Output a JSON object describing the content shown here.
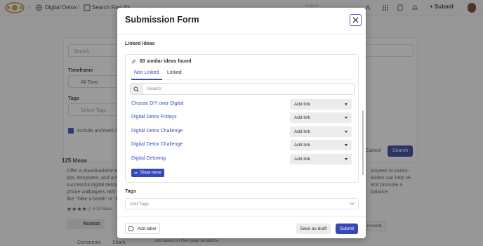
{
  "topbar": {
    "breadcrumb_sep_1": "/",
    "breadcrumb_1": "Digital Detox",
    "breadcrumb_sep_2": "/",
    "breadcrumb_2": "Search Results",
    "search_placeholder": "Search",
    "submit_label": "Submit"
  },
  "background": {
    "search_placeholder": "Search",
    "timeframe_label": "Timeframe",
    "timeframe_value": "All Time",
    "tags_label": "Tags",
    "tags_placeholder": "Select Tags",
    "include_archived": "Include archived ca",
    "cancel_label": "Cancel",
    "search_btn_label": "Search",
    "ideas_count": "125 Ideas",
    "idea_text_lines": [
      "Offer a downloadable to",
      "tips, templates, and acti",
      "successful digital detox.",
      "phone wallpapers with re",
      "like “Take a break” or “Be"
    ],
    "right_text_lines": [
      "ployees to partici-",
      "tivities can help re-",
      "and promote a",
      "balance."
    ],
    "rating": "4.13 Stars",
    "assess_label": "Assess",
    "comments_label": "Comments",
    "share_label": "Share",
    "rewards_label": "rewards",
    "bottom_snippet": "ues based on their peak productiv-"
  },
  "modal": {
    "title": "Submission Form",
    "linked_ideas_label": "Linked Ideas",
    "similar_found": "60 similar ideas found",
    "tabs": [
      {
        "label": "Non Linked",
        "active": true
      },
      {
        "label": "Linked",
        "active": false
      }
    ],
    "search_placeholder": "Search",
    "ideas": [
      {
        "title": "Choose DIY over Digital",
        "action": "Add link"
      },
      {
        "title": "Digital Detox Fridays",
        "action": "Add link"
      },
      {
        "title": "Digital Detox Challenge",
        "action": "Add link"
      },
      {
        "title": "Digital Detox Challenge",
        "action": "Add link"
      },
      {
        "title": "Digital Detoxing",
        "action": "Add link"
      }
    ],
    "show_more_label": "Show more",
    "tags_label": "Tags",
    "tags_placeholder": "Add Tags",
    "add_label": "Add label",
    "save_draft": "Save as draft",
    "submit": "Submit"
  },
  "colors": {
    "accent": "#3647b7",
    "link": "#3b4fbf",
    "overlay": "#282828"
  }
}
